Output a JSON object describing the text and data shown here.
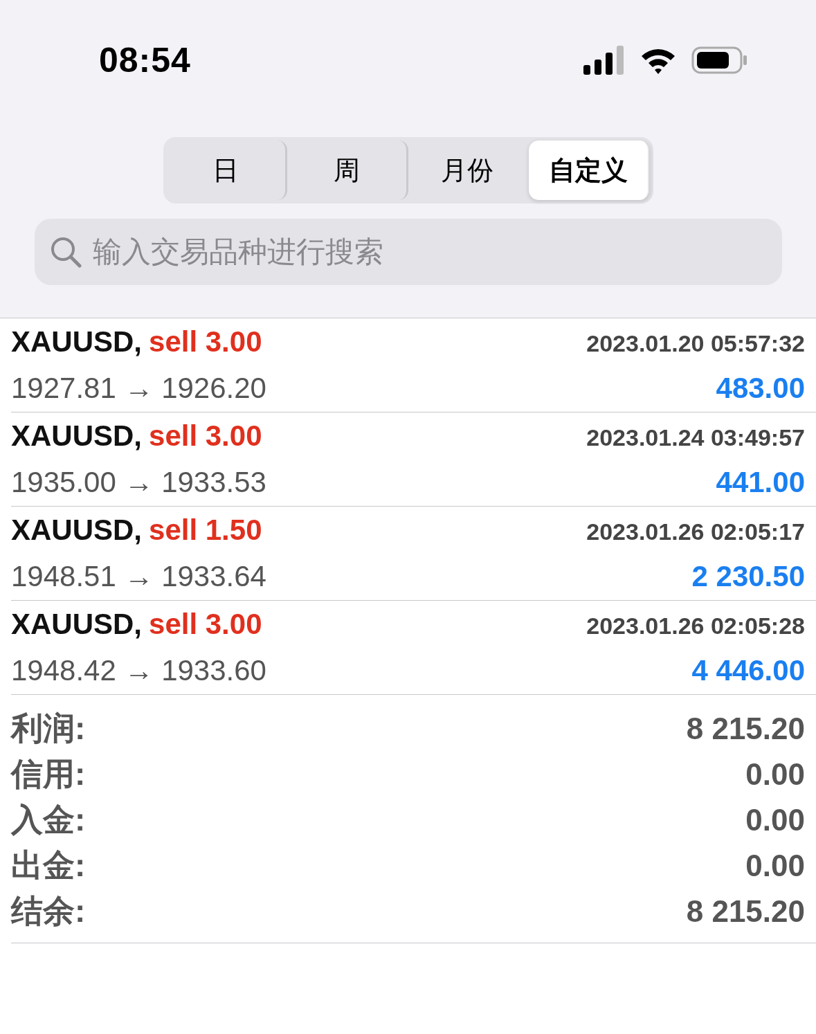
{
  "status_bar": {
    "time": "08:54"
  },
  "period_tabs": [
    {
      "label": "日",
      "selected": false
    },
    {
      "label": "周",
      "selected": false
    },
    {
      "label": "月份",
      "selected": false
    },
    {
      "label": "自定义",
      "selected": true
    }
  ],
  "search": {
    "placeholder": "输入交易品种进行搜索"
  },
  "trades": [
    {
      "symbol": "XAUUSD,",
      "side": "sell 3.00",
      "time": "2023.01.20 05:57:32",
      "prices": "1927.81 → 1926.20",
      "profit": "483.00"
    },
    {
      "symbol": "XAUUSD,",
      "side": "sell 3.00",
      "time": "2023.01.24 03:49:57",
      "prices": "1935.00 → 1933.53",
      "profit": "441.00"
    },
    {
      "symbol": "XAUUSD,",
      "side": "sell 1.50",
      "time": "2023.01.26 02:05:17",
      "prices": "1948.51 → 1933.64",
      "profit": "2 230.50"
    },
    {
      "symbol": "XAUUSD,",
      "side": "sell 3.00",
      "time": "2023.01.26 02:05:28",
      "prices": "1948.42 → 1933.60",
      "profit": "4 446.00"
    }
  ],
  "summary": [
    {
      "label": "利润:",
      "value": "8 215.20"
    },
    {
      "label": "信用:",
      "value": "0.00"
    },
    {
      "label": "入金:",
      "value": "0.00"
    },
    {
      "label": "出金:",
      "value": "0.00"
    },
    {
      "label": "结余:",
      "value": "8 215.20"
    }
  ]
}
